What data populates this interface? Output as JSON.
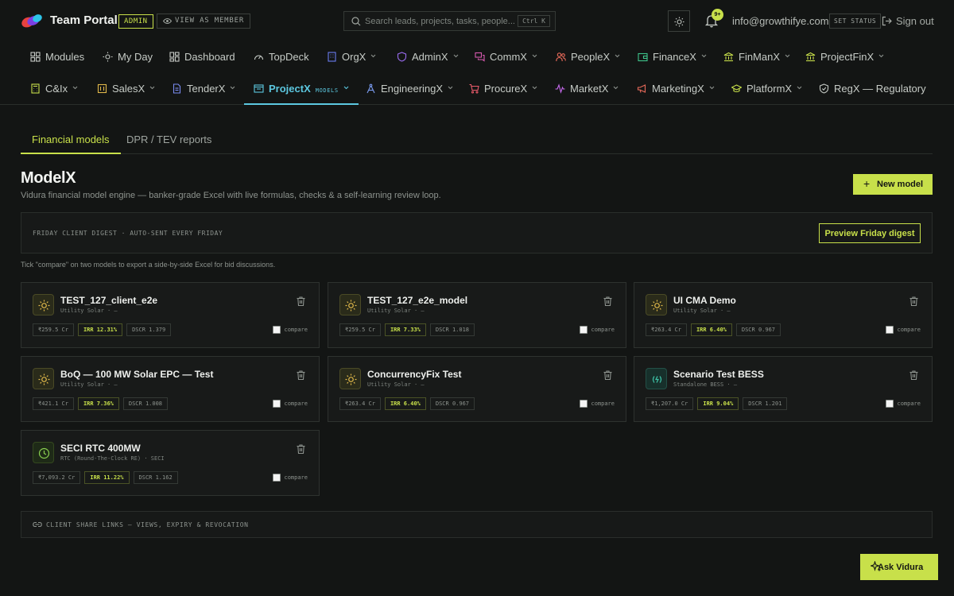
{
  "header": {
    "brand": "Team Portal",
    "role_badge": "ADMIN",
    "view_as_label": "VIEW AS MEMBER",
    "search_placeholder": "Search leads, projects, tasks, people...",
    "search_shortcut": "Ctrl K",
    "notification_count": "9+",
    "email": "info@growthifye.com",
    "set_status_label": "SET STATUS",
    "sign_out_label": "Sign out",
    "logo_colors": [
      "#e8423f",
      "#7b3fe4",
      "#2ec4e8"
    ]
  },
  "nav_row1": [
    {
      "label": "Modules",
      "icon": "grid-icon",
      "has_menu": false
    },
    {
      "label": "My Day",
      "icon": "sun-icon",
      "has_menu": false
    },
    {
      "label": "Dashboard",
      "icon": "dashboard-icon",
      "has_menu": false
    },
    {
      "label": "TopDeck",
      "icon": "gauge-icon",
      "has_menu": false
    },
    {
      "label": "OrgX",
      "icon": "building-icon",
      "has_menu": true
    },
    {
      "label": "AdminX",
      "icon": "shield-icon",
      "has_menu": true
    },
    {
      "label": "CommX",
      "icon": "chat-icon",
      "has_menu": true
    },
    {
      "label": "PeopleX",
      "icon": "people-icon",
      "has_menu": true
    },
    {
      "label": "FinanceX",
      "icon": "wallet-icon",
      "has_menu": true
    },
    {
      "label": "FinManX",
      "icon": "bank-icon",
      "has_menu": true
    },
    {
      "label": "ProjectFinX",
      "icon": "bank-icon",
      "has_menu": true
    }
  ],
  "nav_row2": [
    {
      "label": "C&Ix",
      "icon": "calculator-icon",
      "has_menu": true
    },
    {
      "label": "SalesX",
      "icon": "sales-icon",
      "has_menu": true
    },
    {
      "label": "TenderX",
      "icon": "document-icon",
      "has_menu": true
    },
    {
      "label": "ProjectX",
      "icon": "project-icon",
      "has_menu": true,
      "active": true,
      "tag": "MODELS"
    },
    {
      "label": "EngineeringX",
      "icon": "compass-icon",
      "has_menu": true
    },
    {
      "label": "ProcureX",
      "icon": "cart-icon",
      "has_menu": true
    },
    {
      "label": "MarketX",
      "icon": "pulse-icon",
      "has_menu": true
    },
    {
      "label": "MarketingX",
      "icon": "megaphone-icon",
      "has_menu": true
    },
    {
      "label": "PlatformX",
      "icon": "graduation-cap-icon",
      "has_menu": true
    },
    {
      "label": "RegX — Regulatory",
      "icon": "shield-check-icon",
      "has_menu": false
    }
  ],
  "tabs": [
    {
      "label": "Financial models",
      "active": true
    },
    {
      "label": "DPR / TEV reports",
      "active": false
    }
  ],
  "page": {
    "title": "ModelX",
    "subtitle": "Vidura financial model engine — banker-grade Excel with live formulas, checks & a self-learning review loop.",
    "new_model_label": "New model",
    "digest_label": "FRIDAY CLIENT DIGEST · AUTO-SENT EVERY FRIDAY",
    "digest_button": "Preview Friday digest",
    "hint": "Tick \"compare\" on two models to export a side-by-side Excel for bid discussions.",
    "share_label": "CLIENT SHARE LINKS — VIEWS, EXPIRY & REVOCATION",
    "ask_label": "Ask Vidura"
  },
  "models": [
    {
      "name": "TEST_127_client_e2e",
      "meta": "Utility Solar · –",
      "capex": "₹259.5 Cr",
      "irr": "IRR 12.31%",
      "dscr": "DSCR 1.379",
      "icon": "sun-icon",
      "compare_label": "compare"
    },
    {
      "name": "TEST_127_e2e_model",
      "meta": "Utility Solar · –",
      "capex": "₹259.5 Cr",
      "irr": "IRR 7.33%",
      "dscr": "DSCR 1.018",
      "icon": "sun-icon",
      "compare_label": "compare"
    },
    {
      "name": "UI CMA Demo",
      "meta": "Utility Solar · –",
      "capex": "₹263.4 Cr",
      "irr": "IRR 6.40%",
      "dscr": "DSCR 0.967",
      "icon": "sun-icon",
      "compare_label": "compare"
    },
    {
      "name": "BoQ — 100 MW Solar EPC — Test",
      "meta": "Utility Solar · –",
      "capex": "₹421.1 Cr",
      "irr": "IRR 7.36%",
      "dscr": "DSCR 1.008",
      "icon": "sun-icon",
      "compare_label": "compare"
    },
    {
      "name": "ConcurrencyFix Test",
      "meta": "Utility Solar · –",
      "capex": "₹263.4 Cr",
      "irr": "IRR 6.40%",
      "dscr": "DSCR 0.967",
      "icon": "sun-icon",
      "compare_label": "compare"
    },
    {
      "name": "Scenario Test BESS",
      "meta": "Standalone BESS · –",
      "capex": "₹1,207.0 Cr",
      "irr": "IRR 9.04%",
      "dscr": "DSCR 1.201",
      "icon": "battery-icon",
      "compare_label": "compare"
    },
    {
      "name": "SECI RTC 400MW",
      "meta": "RTC (Round-The-Clock RE) · SECI",
      "capex": "₹7,093.2 Cr",
      "irr": "IRR 11.22%",
      "dscr": "DSCR 1.162",
      "icon": "clock-icon",
      "compare_label": "compare"
    }
  ],
  "colors": {
    "accent": "#c8e04a",
    "active_nav": "#5cc8e0",
    "background": "#131514",
    "card": "#181a19"
  }
}
